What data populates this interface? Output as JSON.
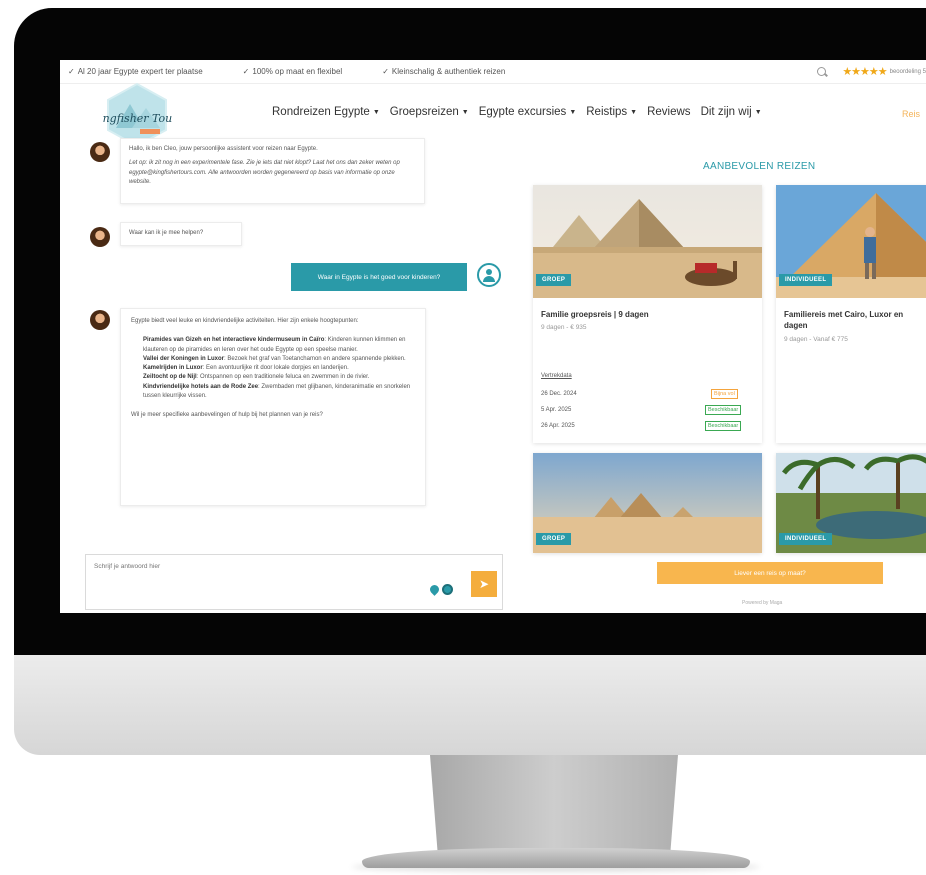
{
  "topbar": {
    "usps": [
      "Al 20 jaar Egypte expert ter plaatse",
      "100% op maat en flexibel",
      "Kleinschalig & authentiek reizen"
    ],
    "stars": "★★★★★",
    "rating_text": "beoordeling 5"
  },
  "header": {
    "logo_text": "Kingfisher Tours",
    "nav": [
      {
        "label": "Rondreizen Egypte"
      },
      {
        "label": "Groepsreizen"
      },
      {
        "label": "Egypte excursies"
      },
      {
        "label": "Reistips"
      },
      {
        "label": "Reviews",
        "no_chevron": true
      },
      {
        "label": "Dit zijn wij"
      }
    ],
    "cta": "Reis"
  },
  "chat": {
    "intro": "Hallo, ik ben Cleo, jouw persoonlijke assistent voor reizen naar Egypte.",
    "note": "Let op: ik zit nog in een experimentele fase. Zie je iets dat niet klopt? Laat het ons dan zeker weten op egypte@kingfishertours.com. Alle antwoorden worden gegenereerd op basis van informatie op onze website.",
    "question": "Waar kan ik je mee helpen?",
    "user_message": "Waar in Egypte is het goed voor kinderen?",
    "answer_intro": "Egypte biedt veel leuke en kindvriendelijke activiteiten. Hier zijn enkele hoogtepunten:",
    "highlights": [
      {
        "title": "Piramides van Gizeh en het interactieve kindermuseum in Caïro",
        "text": ": Kinderen kunnen klimmen en klauteren op de piramides en leren over het oude Egypte op een speelse manier."
      },
      {
        "title": "Vallei der Koningen in Luxor",
        "text": ": Bezoek het graf van Toetanchamon en andere spannende plekken."
      },
      {
        "title": "Kamelrijden in Luxor",
        "text": ": Een avontuurlijke rit door lokale dorpjes en landerijen."
      },
      {
        "title": "Zeiltocht op de Nijl",
        "text": ": Ontspannen op een traditionele feluca en zwemmen in de rivier."
      },
      {
        "title": "Kindvriendelijke hotels aan de Rode Zee",
        "text": ": Zwembaden met glijbanen, kinderanimatie en snorkelen tussen kleurrijke vissen."
      }
    ],
    "answer_outro": "Wil je meer specifieke aanbevelingen of hulp bij het plannen van je reis?",
    "input_placeholder": "Schrijf je antwoord hier"
  },
  "recommended": {
    "title": "AANBEVOLEN REIZEN",
    "cards": [
      {
        "badge": "GROEP",
        "title": "Familie groepsreis | 9 dagen",
        "sub": "9 dagen - € 935",
        "departures_label": "Vertrekdata",
        "departures": [
          {
            "date": "26 Dec. 2024",
            "status": "Bijna vol",
            "color": "orange"
          },
          {
            "date": "5 Apr. 2025",
            "status": "Beschikbaar",
            "color": "green"
          },
          {
            "date": "26 Apr. 2025",
            "status": "Beschikbaar",
            "color": "green"
          }
        ]
      },
      {
        "badge": "INDIVIDUEEL",
        "title": "Familiereis met Cairo, Luxor en",
        "title2": "dagen",
        "sub": "9 dagen - Vanaf € 775"
      },
      {
        "badge": "GROEP"
      },
      {
        "badge": "INDIVIDUEEL"
      }
    ],
    "cta": "Liever een reis op maat?",
    "powered": "Powered by Maga"
  },
  "colors": {
    "teal": "#2a9aa8",
    "orange": "#f4ad3d",
    "star": "#f0a818"
  }
}
